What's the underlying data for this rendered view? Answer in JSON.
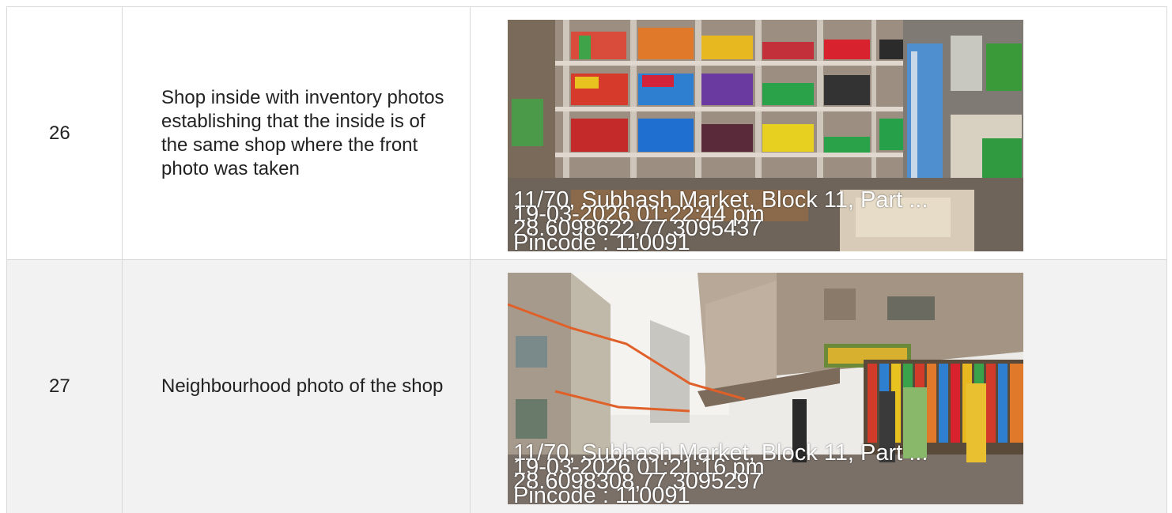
{
  "rows": [
    {
      "number": "26",
      "description": "Shop inside with inventory photos establishing that the inside is of the same shop where the front photo was taken",
      "photo": {
        "address": "11/70, Subhash Market, Block 11, Part ...",
        "datetime": "19-03-2026 01:22:44 pm",
        "coordinates": "28.6098622,77.3095437",
        "pincode": "Pincode : 110091"
      }
    },
    {
      "number": "27",
      "description": "Neighbourhood photo of the shop",
      "photo": {
        "address": "11/70, Subhash Market, Block 11, Part ...",
        "datetime": "19-03-2026 01:21:16 pm",
        "coordinates": "28.6098308,77.3095297",
        "pincode": "Pincode : 110091"
      }
    }
  ]
}
